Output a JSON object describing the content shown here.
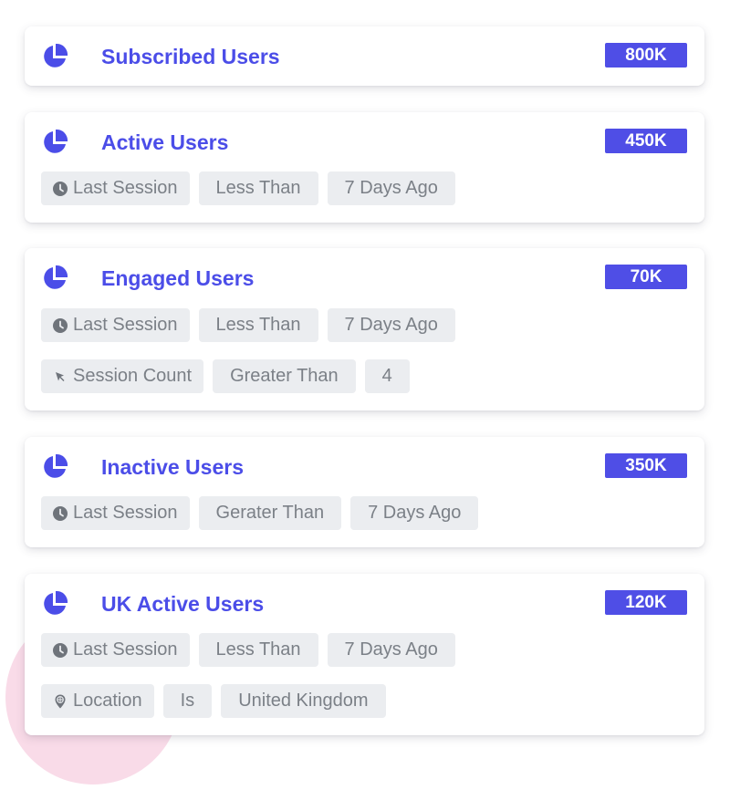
{
  "colors": {
    "accent": "#4b4de8",
    "badge_bg": "#4f4ee6",
    "chip_bg": "#ebedf0",
    "chip_text": "#7b8087",
    "blob": "#f9dbe8"
  },
  "segments": [
    {
      "title": "Subscribed Users",
      "count": "800K",
      "icon": "pie-chart-icon",
      "filters": []
    },
    {
      "title": "Active Users",
      "count": "450K",
      "icon": "pie-chart-icon",
      "filters": [
        {
          "field": "Last Session",
          "field_icon": "clock-icon",
          "operator": "Less Than",
          "value": "7 Days Ago"
        }
      ]
    },
    {
      "title": "Engaged Users",
      "count": "70K",
      "icon": "pie-chart-icon",
      "filters": [
        {
          "field": "Last Session",
          "field_icon": "clock-icon",
          "operator": "Less Than",
          "value": "7 Days Ago"
        },
        {
          "field": "Session Count",
          "field_icon": "cursor-icon",
          "operator": "Greater Than",
          "value": "4"
        }
      ]
    },
    {
      "title": "Inactive Users",
      "count": "350K",
      "icon": "pie-chart-icon",
      "filters": [
        {
          "field": "Last Session",
          "field_icon": "clock-icon",
          "operator": "Gerater Than",
          "value": "7 Days Ago"
        }
      ]
    },
    {
      "title": "UK Active Users",
      "count": "120K",
      "icon": "pie-chart-icon",
      "filters": [
        {
          "field": "Last Session",
          "field_icon": "clock-icon",
          "operator": "Less Than",
          "value": "7 Days Ago"
        },
        {
          "field": "Location",
          "field_icon": "location-pin-icon",
          "operator": "Is",
          "value": "United Kingdom"
        }
      ]
    }
  ]
}
